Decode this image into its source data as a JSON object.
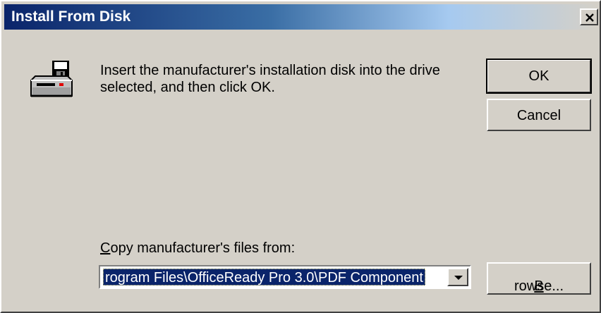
{
  "window": {
    "title": "Install From Disk"
  },
  "message": {
    "text": "Insert the manufacturer's installation disk into the drive selected, and then click OK."
  },
  "buttons": {
    "ok_label": "OK",
    "cancel_label": "Cancel",
    "browse_prefix": "B",
    "browse_rest": "rowse..."
  },
  "copy_from": {
    "label_prefix": "C",
    "label_rest": "opy manufacturer's files from:",
    "value": "rogram Files\\OfficeReady Pro 3.0\\PDF Component"
  },
  "icons": {
    "disk": "floppy-disk-drive-icon",
    "close": "close-icon",
    "dropdown": "dropdown-arrow-icon"
  },
  "colors": {
    "titlebar_start": "#0a246a",
    "titlebar_end": "#a6caf0",
    "face": "#d4d0c8",
    "selection": "#0a246a"
  }
}
